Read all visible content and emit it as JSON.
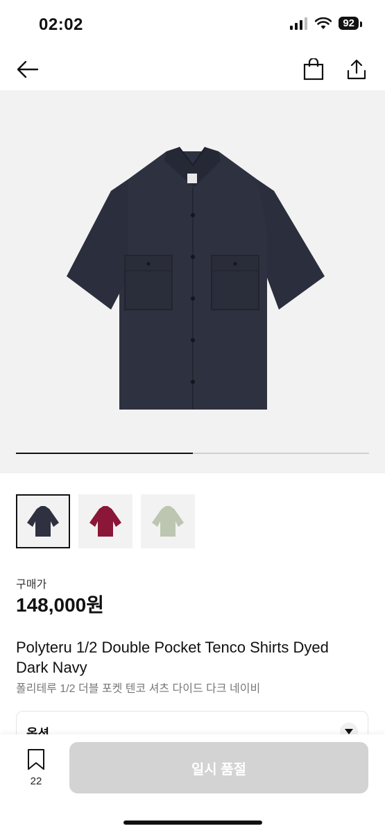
{
  "status_bar": {
    "time": "02:02",
    "battery": "92"
  },
  "nav": {
    "back_icon": "arrow-left-icon",
    "bag_icon": "shopping-bag-icon",
    "share_icon": "share-icon"
  },
  "gallery": {
    "progress": 0.5,
    "thumbnails": [
      {
        "name": "navy",
        "color": "#2e3140"
      },
      {
        "name": "burgundy",
        "color": "#8a1737"
      },
      {
        "name": "sage",
        "color": "#bcc6b0"
      }
    ],
    "selected_index": 0
  },
  "product": {
    "price_label": "구매가",
    "price": "148,000원",
    "title_en": "Polyteru 1/2 Double Pocket Tenco Shirts Dyed Dark Navy",
    "title_ko": "폴리테루 1/2 더블 포켓 텐코 셔츠 다이드 다크 네이비"
  },
  "options": {
    "label": "옵션"
  },
  "bottom_bar": {
    "bookmark_count": "22",
    "cta_label": "일시 품절"
  },
  "colors": {
    "shirt_main": "#2e3140",
    "hero_bg": "#f2f2f2",
    "cta_disabled": "#d3d3d3"
  }
}
